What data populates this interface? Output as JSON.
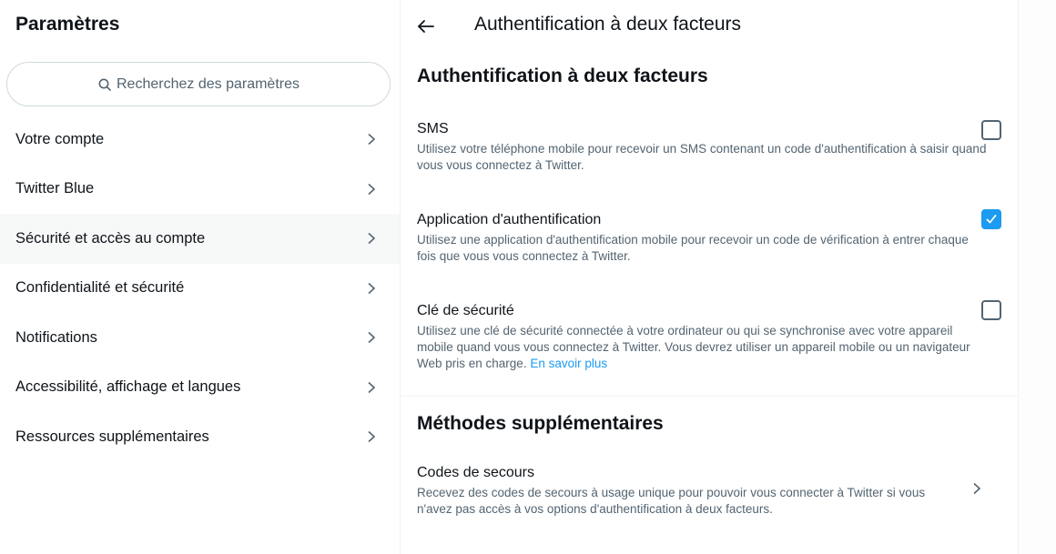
{
  "sidebar": {
    "title": "Paramètres",
    "search_placeholder": "Recherchez des paramètres",
    "items": [
      {
        "label": "Votre compte",
        "active": false
      },
      {
        "label": "Twitter Blue",
        "active": false
      },
      {
        "label": "Sécurité et accès au compte",
        "active": true
      },
      {
        "label": "Confidentialité et sécurité",
        "active": false
      },
      {
        "label": "Notifications",
        "active": false
      },
      {
        "label": "Accessibilité, affichage et langues",
        "active": false
      },
      {
        "label": "Ressources supplémentaires",
        "active": false
      }
    ]
  },
  "main": {
    "header_title": "Authentification à deux facteurs",
    "section1_title": "Authentification à deux facteurs",
    "options": [
      {
        "label": "SMS",
        "description": "Utilisez votre téléphone mobile pour recevoir un SMS contenant un code d'authentification à saisir quand vous vous connectez à Twitter.",
        "checked": false
      },
      {
        "label": "Application d'authentification",
        "description": "Utilisez une application d'authentification mobile pour recevoir un code de vérification à entrer chaque fois que vous vous connectez à Twitter.",
        "checked": true
      },
      {
        "label": "Clé de sécurité",
        "description": "Utilisez une clé de sécurité connectée à votre ordinateur ou qui se synchronise avec votre appareil mobile quand vous vous connectez à Twitter. Vous devrez utiliser un appareil mobile ou un navigateur Web pris en charge.",
        "link": "En savoir plus",
        "checked": false
      }
    ],
    "section2_title": "Méthodes supplémentaires",
    "backup": {
      "label": "Codes de secours",
      "description": "Recevez des codes de secours à usage unique pour pouvoir vous connecter à Twitter si vous n'avez pas accès à vos options d'authentification à deux facteurs."
    }
  },
  "colors": {
    "accent": "#1d9bf0",
    "text_primary": "#0f1419",
    "text_secondary": "#536471",
    "active_bg": "#f7f9f9"
  }
}
